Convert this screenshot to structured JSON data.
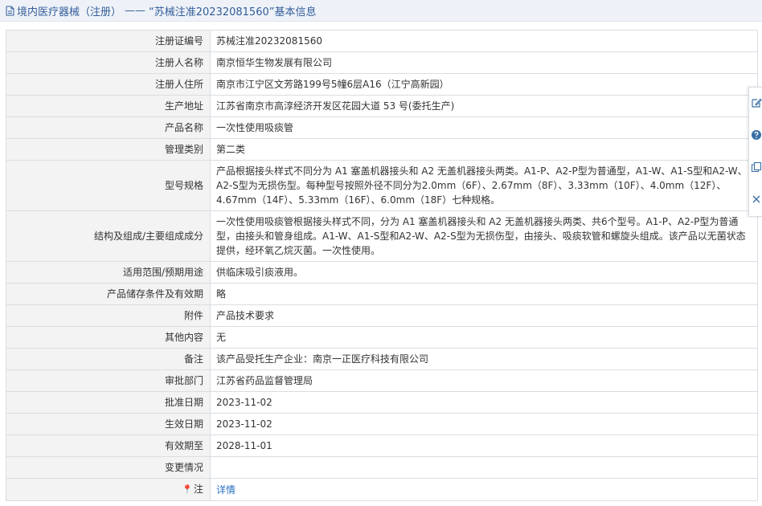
{
  "header": {
    "category": "境内医疗器械（注册）",
    "separator": "——",
    "title": "“苏械注准20232081560”基本信息"
  },
  "rows": [
    {
      "label": "注册证编号",
      "value": "苏械注准20232081560"
    },
    {
      "label": "注册人名称",
      "value": "南京恒华生物发展有限公司"
    },
    {
      "label": "注册人住所",
      "value": "南京市江宁区文芳路199号5幢6层A16（江宁高新园）"
    },
    {
      "label": "生产地址",
      "value": "江苏省南京市高淳经济开发区花园大道 53 号(委托生产)"
    },
    {
      "label": "产品名称",
      "value": "一次性使用吸痰管"
    },
    {
      "label": "管理类别",
      "value": "第二类"
    },
    {
      "label": "型号规格",
      "value": "产品根据接头样式不同分为 A1 塞盖机器接头和 A2 无盖机器接头两类。A1-P、A2-P型为普通型，A1-W、A1-S型和A2-W、A2-S型为无损伤型。每种型号按照外径不同分为2.0mm（6F）、2.67mm（8F）、3.33mm（10F）、4.0mm（12F）、4.67mm（14F）、5.33mm（16F）、6.0mm（18F）七种规格。"
    },
    {
      "label": "结构及组成/主要组成成分",
      "value": "一次性使用吸痰管根据接头样式不同，分为 A1 塞盖机器接头和 A2 无盖机器接头两类、共6个型号。A1-P、A2-P型为普通型，由接头和管身组成。A1-W、A1-S型和A2-W、A2-S型为无损伤型，由接头、吸痰软管和螺旋头组成。该产品以无菌状态提供，经环氧乙烷灭菌。一次性使用。"
    },
    {
      "label": "适用范围/预期用途",
      "value": "供临床吸引痰液用。"
    },
    {
      "label": "产品储存条件及有效期",
      "value": "略"
    },
    {
      "label": "附件",
      "value": "产品技术要求"
    },
    {
      "label": "其他内容",
      "value": "无"
    },
    {
      "label": "备注",
      "value": "该产品受托生产企业：南京一正医疗科技有限公司"
    },
    {
      "label": "审批部门",
      "value": "江苏省药品监督管理局"
    },
    {
      "label": "批准日期",
      "value": "2023-11-02"
    },
    {
      "label": "生效日期",
      "value": "2023-11-02"
    },
    {
      "label": "有效期至",
      "value": "2028-11-01"
    },
    {
      "label": "变更情况",
      "value": ""
    }
  ],
  "note_row": {
    "pin_icon": "📍",
    "label": "注",
    "link": "详情"
  },
  "colors": {
    "header_bg": "#eef2f8",
    "header_text": "#335d9a",
    "label_bg": "#f3f3f3",
    "border": "#d9dde3",
    "link": "#2a6fc1"
  },
  "side_toolbar": {
    "icons": [
      "edit-icon",
      "help-icon",
      "copy-icon",
      "close-icon"
    ]
  }
}
